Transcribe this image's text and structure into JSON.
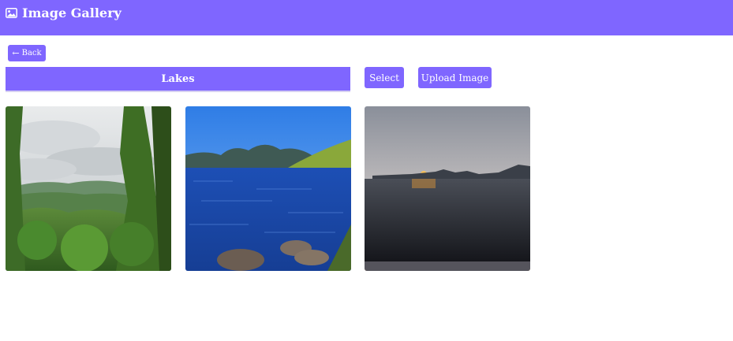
{
  "header": {
    "title": "Image Gallery",
    "icon": "image-icon",
    "bg_color": "#7f66ff"
  },
  "toolbar": {
    "back_label": "Back",
    "back_icon": "arrow-left-icon",
    "album_title": "Lakes",
    "select_label": "Select",
    "upload_label": "Upload Image"
  },
  "gallery": {
    "images": [
      {
        "subject": "forest-view"
      },
      {
        "subject": "blue-lake-mountains"
      },
      {
        "subject": "sunset-lake"
      }
    ]
  }
}
